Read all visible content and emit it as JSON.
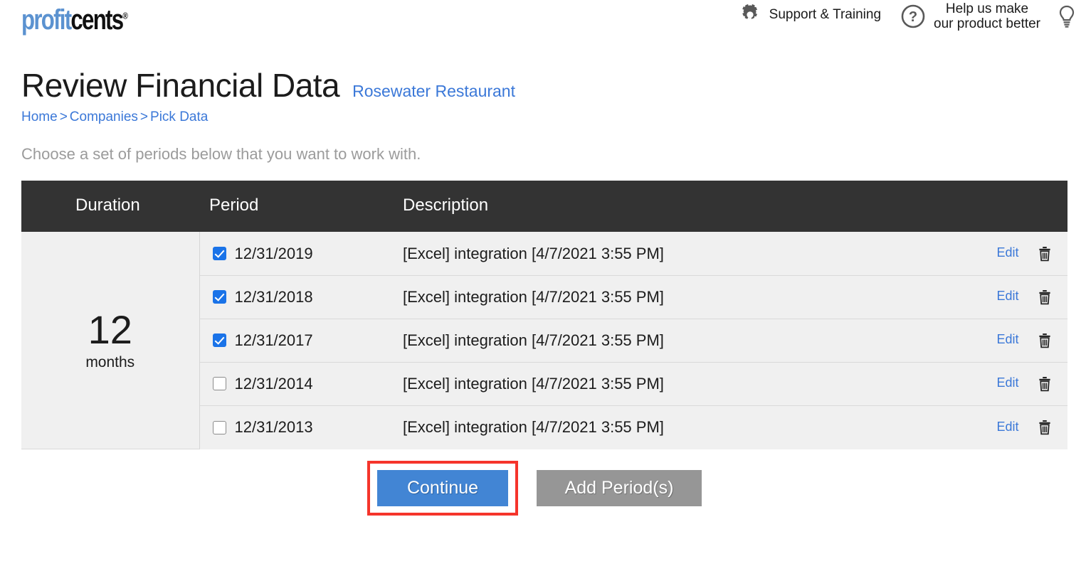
{
  "header": {
    "logo": {
      "part1": "profit",
      "part2": "cents",
      "registered": "®"
    },
    "items": [
      {
        "icon": "gear-icon",
        "label": "Support & Training"
      },
      {
        "icon": "question-circle-icon",
        "label_line1": "Help us make",
        "label_line2": "our product better"
      },
      {
        "icon": "lightbulb-icon",
        "label": ""
      }
    ]
  },
  "page": {
    "title": "Review Financial Data",
    "company": "Rosewater Restaurant",
    "instruction": "Choose a set of periods below that you want to work with."
  },
  "breadcrumb": {
    "items": [
      "Home",
      "Companies",
      "Pick Data"
    ],
    "separator": ">"
  },
  "table": {
    "columns": {
      "duration": "Duration",
      "period": "Period",
      "description": "Description"
    },
    "duration_group": {
      "number": "12",
      "unit": "months"
    },
    "rows": [
      {
        "checked": true,
        "date": "12/31/2019",
        "description": "[Excel] integration [4/7/2021 3:55 PM]",
        "edit": "Edit",
        "delete_icon": "trash-icon"
      },
      {
        "checked": true,
        "date": "12/31/2018",
        "description": "[Excel] integration [4/7/2021 3:55 PM]",
        "edit": "Edit",
        "delete_icon": "trash-icon"
      },
      {
        "checked": true,
        "date": "12/31/2017",
        "description": "[Excel] integration [4/7/2021 3:55 PM]",
        "edit": "Edit",
        "delete_icon": "trash-icon"
      },
      {
        "checked": false,
        "date": "12/31/2014",
        "description": "[Excel] integration [4/7/2021 3:55 PM]",
        "edit": "Edit",
        "delete_icon": "trash-icon"
      },
      {
        "checked": false,
        "date": "12/31/2013",
        "description": "[Excel] integration [4/7/2021 3:55 PM]",
        "edit": "Edit",
        "delete_icon": "trash-icon"
      }
    ]
  },
  "buttons": {
    "continue": "Continue",
    "add_periods": "Add Period(s)"
  },
  "colors": {
    "logo_blue": "#5b92d0",
    "link_blue": "#3b78d8",
    "checkbox_blue": "#1a73e8",
    "continue_blue": "#4285d4",
    "add_gray": "#969696",
    "header_dark": "#333333",
    "row_gray": "#f0f0f0",
    "highlight_red": "#f5342b",
    "instruction_gray": "#9b9b9b"
  },
  "annotation": {
    "highlighted_element": "continue-button"
  }
}
